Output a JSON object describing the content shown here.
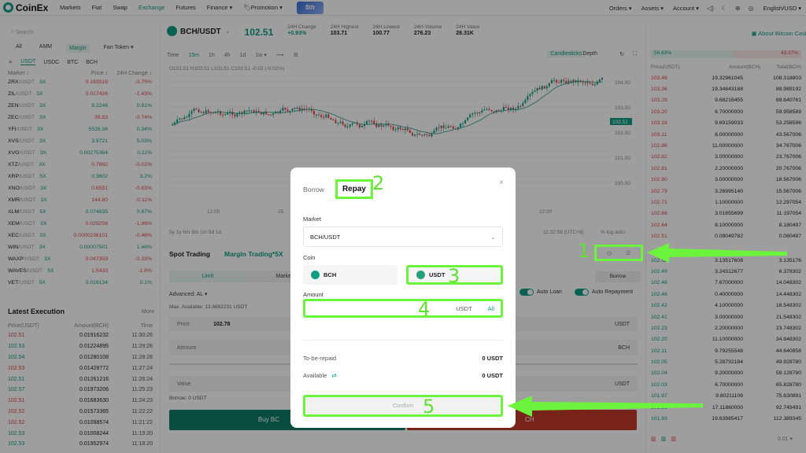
{
  "topnav": {
    "logo": "CoinEx",
    "items": [
      "Markets",
      "Fiat",
      "Swap",
      "Exchange",
      "Futures",
      "Finance ▾",
      "🏷Promotion ▾"
    ],
    "badge": "5th",
    "right": [
      "Orders ▾",
      "Assets ▾",
      "Account ▾",
      "English/USD ▾"
    ]
  },
  "left": {
    "search_placeholder": "Search",
    "tabs": [
      "All",
      "AMM",
      "Margin",
      "Fan Token ▾"
    ],
    "quote_tabs": [
      "USDT",
      "USDC",
      "BTC",
      "BCH"
    ],
    "headers": [
      "Market ↕",
      "Price ↕",
      "24H Change ↕"
    ],
    "markets": [
      {
        "p": "ZRX",
        "q": "/USDT",
        "lev": "3X",
        "price": "0.163519",
        "chg": "-0.75%",
        "up": false
      },
      {
        "p": "ZIL",
        "q": "/USDT",
        "lev": "3X",
        "price": "0.017426",
        "chg": "-1.43%",
        "up": false
      },
      {
        "p": "ZEN",
        "q": "/USDT",
        "lev": "3X",
        "price": "9.2246",
        "chg": "0.91%",
        "up": true
      },
      {
        "p": "ZEC",
        "q": "/USDT",
        "lev": "3X",
        "price": "39.83",
        "chg": "-0.74%",
        "up": false
      },
      {
        "p": "YFI",
        "q": "/USDT",
        "lev": "3X",
        "price": "5526.36",
        "chg": "0.34%",
        "up": true
      },
      {
        "p": "XVS",
        "q": "/USDT",
        "lev": "3X",
        "price": "3.9721",
        "chg": "5.03%",
        "up": true
      },
      {
        "p": "XVG",
        "q": "/USDT",
        "lev": "3X",
        "price": "0.00275364",
        "chg": "0.11%",
        "up": true
      },
      {
        "p": "XTZ",
        "q": "/USDT",
        "lev": "3X",
        "price": "0.7892",
        "chg": "-0.02%",
        "up": false
      },
      {
        "p": "XRP",
        "q": "/USDT",
        "lev": "5X",
        "price": "0.3602",
        "chg": "3.2%",
        "up": true
      },
      {
        "p": "XNO",
        "q": "/USDT",
        "lev": "3X",
        "price": "0.6551",
        "chg": "-0.63%",
        "up": false
      },
      {
        "p": "XMR",
        "q": "/USDT",
        "lev": "3X",
        "price": "144.80",
        "chg": "-0.11%",
        "up": false
      },
      {
        "p": "XLM",
        "q": "/USDT",
        "lev": "5X",
        "price": "0.074635",
        "chg": "0.67%",
        "up": true
      },
      {
        "p": "XEM",
        "q": "/USDT",
        "lev": "3X",
        "price": "0.029256",
        "chg": "-1.86%",
        "up": false
      },
      {
        "p": "XEC",
        "q": "/USDT",
        "lev": "3X",
        "price": "0.0000236101",
        "chg": "-0.46%",
        "up": false
      },
      {
        "p": "WIN",
        "q": "/USDT",
        "lev": "3X",
        "price": "0.00007501",
        "chg": "1.46%",
        "up": true
      },
      {
        "p": "WAXP",
        "q": "/USDT",
        "lev": "3X",
        "price": "0.047359",
        "chg": "-0.33%",
        "up": false
      },
      {
        "p": "WAVES",
        "q": "/USDT",
        "lev": "5X",
        "price": "1.5433",
        "chg": "-1.8%",
        "up": false
      },
      {
        "p": "VET",
        "q": "/USDT",
        "lev": "5X",
        "price": "0.016134",
        "chg": "0.1%",
        "up": true
      }
    ],
    "exec_title": "Latest Execution",
    "exec_more": "More",
    "exec_headers": [
      "Price(USDT)",
      "Amount(BCH)",
      "Time"
    ],
    "executions": [
      {
        "p": "102.51",
        "a": "0.01916232",
        "t": "11:30:26",
        "up": false
      },
      {
        "p": "102.53",
        "a": "0.01224895",
        "t": "11:29:26",
        "up": true
      },
      {
        "p": "102.54",
        "a": "0.01280108",
        "t": "11:28:26",
        "up": true
      },
      {
        "p": "102.53",
        "a": "0.01428772",
        "t": "11:27:24",
        "up": false
      },
      {
        "p": "102.51",
        "a": "0.01261216",
        "t": "11:26:24",
        "up": true
      },
      {
        "p": "102.57",
        "a": "0.01973206",
        "t": "11:25:23",
        "up": true
      },
      {
        "p": "102.51",
        "a": "0.01683630",
        "t": "11:24:23",
        "up": false
      },
      {
        "p": "102.52",
        "a": "0.01573365",
        "t": "11:22:22",
        "up": false
      },
      {
        "p": "102.52",
        "a": "0.01098574",
        "t": "11:21:22",
        "up": false
      },
      {
        "p": "102.53",
        "a": "0.01008244",
        "t": "11:19:20",
        "up": true
      },
      {
        "p": "102.53",
        "a": "0.01952974",
        "t": "11:18:20",
        "up": true
      }
    ]
  },
  "center": {
    "pair": "BCH/USDT",
    "price": "102.51",
    "stats": [
      {
        "label": "24H Change",
        "value": "+0.93%"
      },
      {
        "label": "24H Highest",
        "value": "103.71"
      },
      {
        "label": "24H Lowest",
        "value": "100.77"
      },
      {
        "label": "24H Volume",
        "value": "276.23"
      },
      {
        "label": "24H Value",
        "value": "28.31K"
      }
    ],
    "about": "About Bitcoin Cash",
    "timeframes": [
      "Time",
      "15m",
      "1h",
      "4h",
      "1d",
      "1w ▾"
    ],
    "candles_btn": "Candlesticks",
    "depth_btn": "Depth",
    "ohlc": "O102.51  H102.51  L102.51  C102.51  -0.02 (-0.02%)",
    "y_ticks": [
      "104.00",
      "103.00",
      "102.00",
      "101.00",
      "100.00"
    ],
    "price_tag": "102.51",
    "x_ticks": [
      "12:00",
      "25",
      "12:00",
      "27",
      "12:00"
    ],
    "range": "5y  1y  6m  3m  1m  5d  1d",
    "clock": "11:32:56 (UTC+8)",
    "scale": "%   log   auto",
    "spot_title": "Spot Trading",
    "margin_title": "Margin Trading*5X",
    "order_tabs": [
      "Limit",
      "Market"
    ],
    "advanced": "Advanced:   AL ▾",
    "max_avail": "Max. Available: 13.6692231 USDT",
    "auto_loan": "Auto Loan",
    "auto_repay": "Auto Repayment",
    "borrow_btn": "Borrow",
    "price_label": "Price",
    "price_value": "102.78",
    "amount_label": "Amount",
    "value_label": "Value",
    "usdt": "USDT",
    "bch": "BCH",
    "borrow_text": "Borrow: 0 USDT",
    "buy_label": "Buy BC",
    "sell_label": "CH"
  },
  "right": {
    "ratio_buy": "56.63%",
    "ratio_sell": "43.37%",
    "headers": [
      "Price(USDT)",
      "Amount(BCH)",
      "Total(BCH)"
    ],
    "asks": [
      [
        "103.46",
        "19.32961045",
        "108.318803"
      ],
      [
        "103.36",
        "19.34843188",
        "88.989192"
      ],
      [
        "103.28",
        "9.68216455",
        "69.640761"
      ],
      [
        "103.20",
        "6.70000000",
        "59.958589"
      ],
      [
        "103.18",
        "9.69159033",
        "53.258596"
      ],
      [
        "103.11",
        "8.00000000",
        "43.567006"
      ],
      [
        "102.86",
        "11.00000000",
        "34.767006"
      ],
      [
        "102.82",
        "3.00000000",
        "23.767006"
      ],
      [
        "102.81",
        "2.20000000",
        "20.767006"
      ],
      [
        "102.80",
        "3.00000000",
        "18.567006"
      ],
      [
        "102.79",
        "3.26995140",
        "15.567006"
      ],
      [
        "102.71",
        "1.10000000",
        "12.297054"
      ],
      [
        "102.66",
        "3.01655699",
        "11.197054"
      ],
      [
        "102.64",
        "8.10000000",
        "8.180497"
      ],
      [
        "102.51",
        "0.08049782",
        "0.080497"
      ]
    ],
    "bids": [
      [
        "102.50",
        "3.13517608",
        "3.135176"
      ],
      [
        "102.49",
        "3.24312677",
        "6.378302"
      ],
      [
        "102.48",
        "7.67000000",
        "14.048302"
      ],
      [
        "102.46",
        "0.40000000",
        "14.448302"
      ],
      [
        "102.42",
        "4.10000000",
        "18.548302"
      ],
      [
        "102.41",
        "3.00000000",
        "21.548302"
      ],
      [
        "102.23",
        "2.20000000",
        "23.748302"
      ],
      [
        "102.20",
        "11.10000000",
        "34.848302"
      ],
      [
        "102.11",
        "9.79255548",
        "44.640858"
      ],
      [
        "102.05",
        "5.28792184",
        "49.928780"
      ],
      [
        "102.04",
        "9.20000000",
        "59.128780"
      ],
      [
        "102.03",
        "6.70000000",
        "65.828780"
      ],
      [
        "101.97",
        "9.80211106",
        "75.630891"
      ],
      [
        "101.93",
        "17.11860000",
        "92.749491"
      ],
      [
        "101.83",
        "19.63985417",
        "112.389345"
      ]
    ],
    "precision": "0.01 ▾"
  },
  "modal": {
    "tab_borrow": "Borrow",
    "tab_repay": "Repay",
    "market_label": "Market",
    "market_value": "BCH/USDT",
    "coin_label": "Coin",
    "coin_bch": "BCH",
    "coin_usdt": "USDT",
    "amount_label": "Amount",
    "amount_unit": "USDT",
    "amount_all": "All",
    "to_be_repaid_label": "To-be-repaid",
    "to_be_repaid_value": "0 USDT",
    "available_label": "Available",
    "available_value": "0 USDT",
    "confirm": "Confirm"
  },
  "annotations": {
    "n1": "1",
    "n2": "2",
    "n3": "3",
    "n4": "4",
    "n5": "5",
    "color": "#6cf33c"
  },
  "colors": {
    "accent": "#0f9d83",
    "red": "#e04646",
    "annot": "#6cf33c"
  }
}
